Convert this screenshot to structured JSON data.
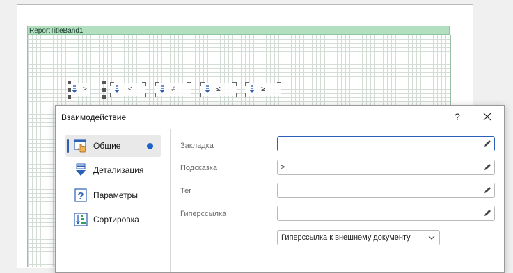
{
  "report": {
    "band_title": "ReportTitleBand1",
    "controls": [
      {
        "symbol": ">"
      },
      {
        "symbol": "<"
      },
      {
        "symbol": "≠"
      },
      {
        "symbol": "≤"
      },
      {
        "symbol": "≥"
      }
    ]
  },
  "dialog": {
    "title": "Взаимодействие",
    "help_label": "?",
    "sidebar": {
      "items": [
        {
          "label": "Общие",
          "icon": "hand-pointer-icon",
          "active": true,
          "indicator": true
        },
        {
          "label": "Детализация",
          "icon": "drilldown-icon"
        },
        {
          "label": "Параметры",
          "icon": "question-icon"
        },
        {
          "label": "Сортировка",
          "icon": "sort-icon"
        }
      ]
    },
    "fields": [
      {
        "label": "Закладка",
        "value": ""
      },
      {
        "label": "Подсказка",
        "value": ">"
      },
      {
        "label": "Тег",
        "value": ""
      },
      {
        "label": "Гиперссылка",
        "value": ""
      }
    ],
    "hyperlink_type": "Гиперссылка к внешнему документу"
  },
  "colors": {
    "accent": "#1e63c9",
    "band": "#b2dfc0"
  }
}
